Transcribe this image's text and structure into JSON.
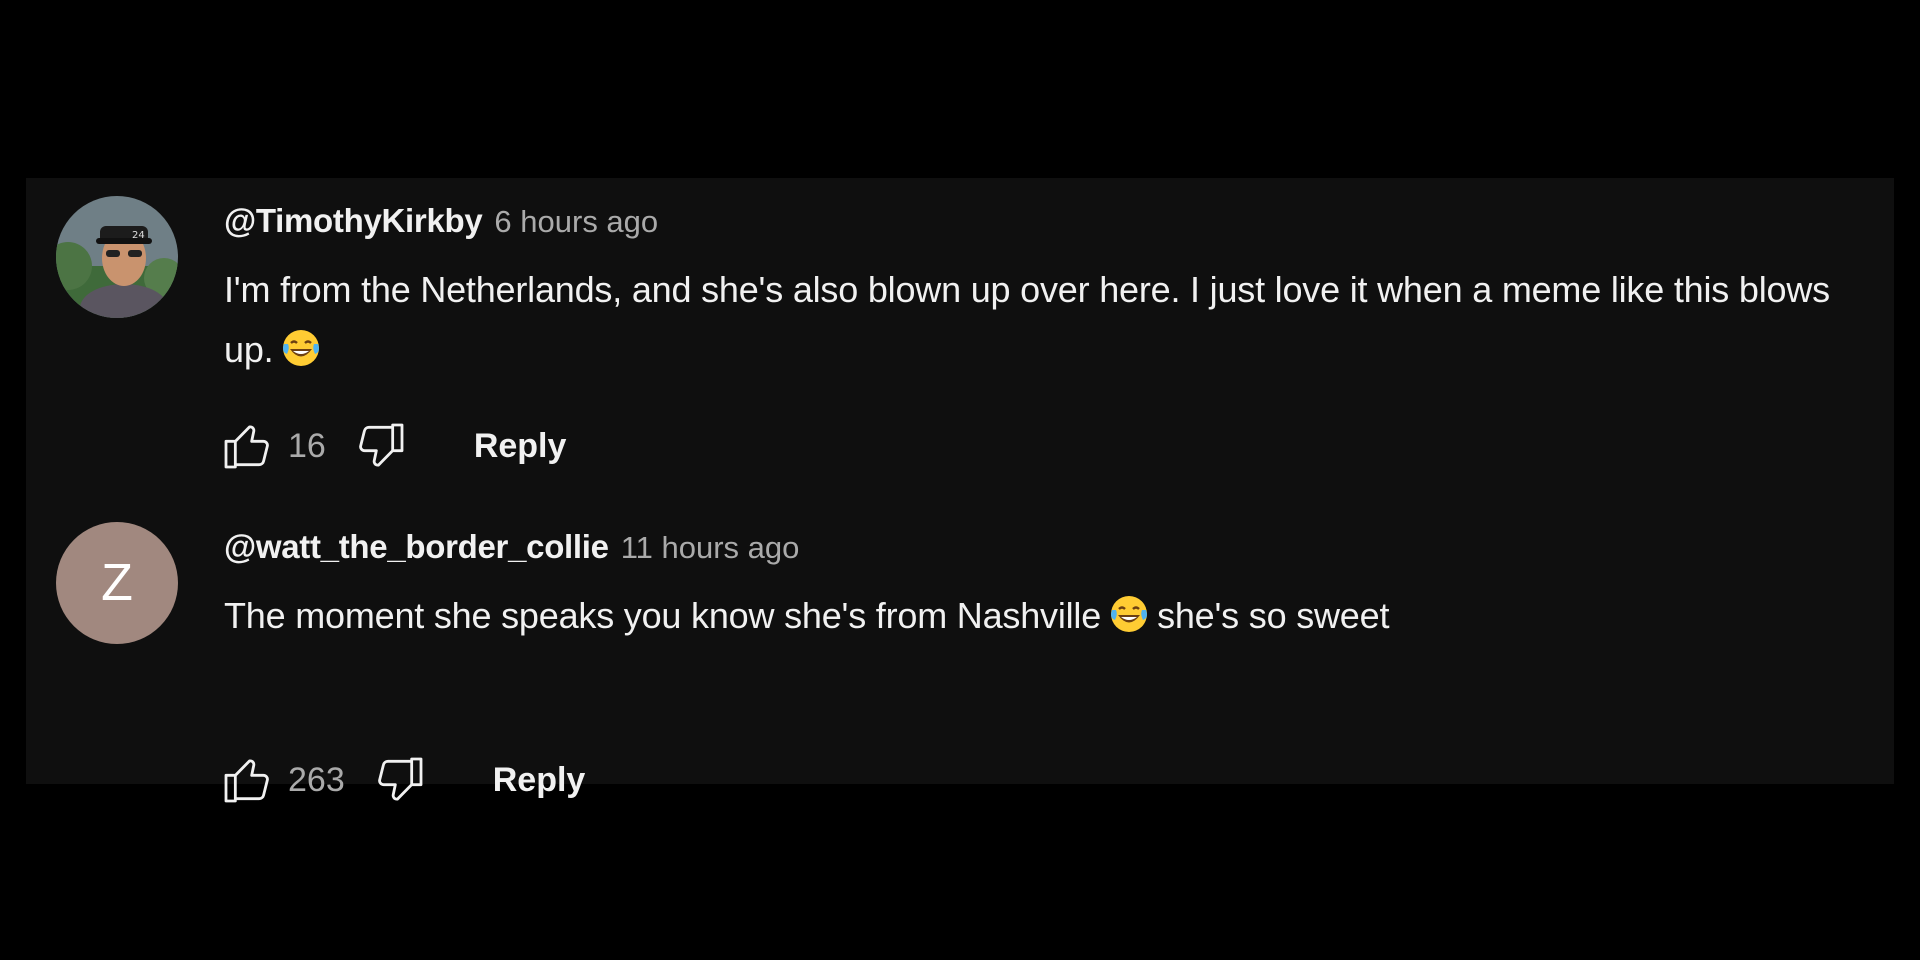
{
  "comments": [
    {
      "author": "@TimothyKirkby",
      "time": "6 hours ago",
      "text_part1": "I'm from the Netherlands, and she's also blown up over here. I just love it when a meme like this blows up.",
      "text_part2": "",
      "likes": "16",
      "reply_label": "Reply",
      "avatar": "photo"
    },
    {
      "author": "@watt_the_border_collie",
      "time": "11 hours ago",
      "text_part1": "The moment she speaks you know she's from Nashville",
      "text_part2": "she's so sweet",
      "likes": "263",
      "reply_label": "Reply",
      "avatar_letter": "Z",
      "avatar_color": "#a1887f"
    }
  ],
  "icons": {
    "like": "thumbs-up-icon",
    "dislike": "thumbs-down-icon",
    "emoji": "laughing-crying-emoji-icon"
  },
  "colors": {
    "background": "#0f0f0f",
    "text": "#f1f1f1",
    "secondary": "#aaaaaa"
  }
}
